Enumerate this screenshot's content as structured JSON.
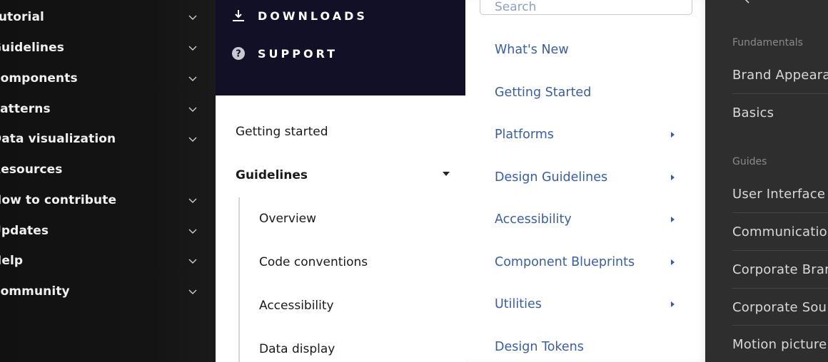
{
  "panel1": {
    "items": [
      {
        "label": "Tutorial",
        "expandable": true
      },
      {
        "label": "Guidelines",
        "expandable": true
      },
      {
        "label": "Components",
        "expandable": true
      },
      {
        "label": "Patterns",
        "expandable": true
      },
      {
        "label": "Data visualization",
        "expandable": true
      },
      {
        "label": "Resources",
        "expandable": false
      },
      {
        "label": "How to contribute",
        "expandable": true
      },
      {
        "label": "Updates",
        "expandable": true
      },
      {
        "label": "Help",
        "expandable": true
      },
      {
        "label": "Community",
        "expandable": true
      }
    ]
  },
  "panel2": {
    "top_items": [
      {
        "label": "DOWNLOADS",
        "icon": "download-icon"
      },
      {
        "label": "SUPPORT",
        "icon": "help-circle-icon"
      }
    ],
    "getting_started": "Getting started",
    "guidelines": "Guidelines",
    "sub_items": [
      "Overview",
      "Code conventions",
      "Accessibility",
      "Data display"
    ]
  },
  "panel3": {
    "search_placeholder": "Search",
    "items": [
      {
        "label": "What's New",
        "submenu": false
      },
      {
        "label": "Getting Started",
        "submenu": false
      },
      {
        "label": "Platforms",
        "submenu": true
      },
      {
        "label": "Design Guidelines",
        "submenu": true
      },
      {
        "label": "Accessibility",
        "submenu": true
      },
      {
        "label": "Component Blueprints",
        "submenu": true
      },
      {
        "label": "Utilities",
        "submenu": true
      },
      {
        "label": "Design Tokens",
        "submenu": false
      }
    ]
  },
  "panel4": {
    "sections": [
      "Fundamentals",
      "Guides"
    ],
    "fundamentals_items": [
      "Brand Appeara",
      "Basics"
    ],
    "guides_items": [
      "User Interface",
      "Communicatio",
      "Corporate Brar",
      "Corporate Sou",
      "Motion picture"
    ]
  },
  "colors": {
    "panel1_bg": "#141414",
    "panel2_header": "#111026",
    "panel3_link": "#3a5f9c",
    "panel4_bg": "#2e2e2e"
  }
}
